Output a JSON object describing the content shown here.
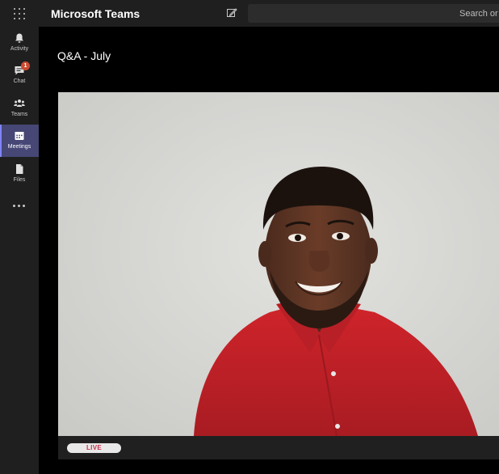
{
  "header": {
    "app_title": "Microsoft Teams",
    "search_placeholder": "Search or t"
  },
  "rail": {
    "items": [
      {
        "label": "Activity",
        "icon": "bell-icon"
      },
      {
        "label": "Chat",
        "icon": "chat-icon",
        "badge": "1"
      },
      {
        "label": "Teams",
        "icon": "teams-icon"
      },
      {
        "label": "Meetings",
        "icon": "calendar-icon",
        "active": true
      },
      {
        "label": "Files",
        "icon": "file-icon"
      }
    ],
    "more_icon": "more-icon"
  },
  "meeting": {
    "title": "Q&A - July",
    "status_badge": "LIVE"
  },
  "colors": {
    "accent": "#464775",
    "accent_bar": "#7f85f5",
    "badge": "#cc4a31",
    "live_text": "#c4314b",
    "shirt": "#c8222b"
  }
}
